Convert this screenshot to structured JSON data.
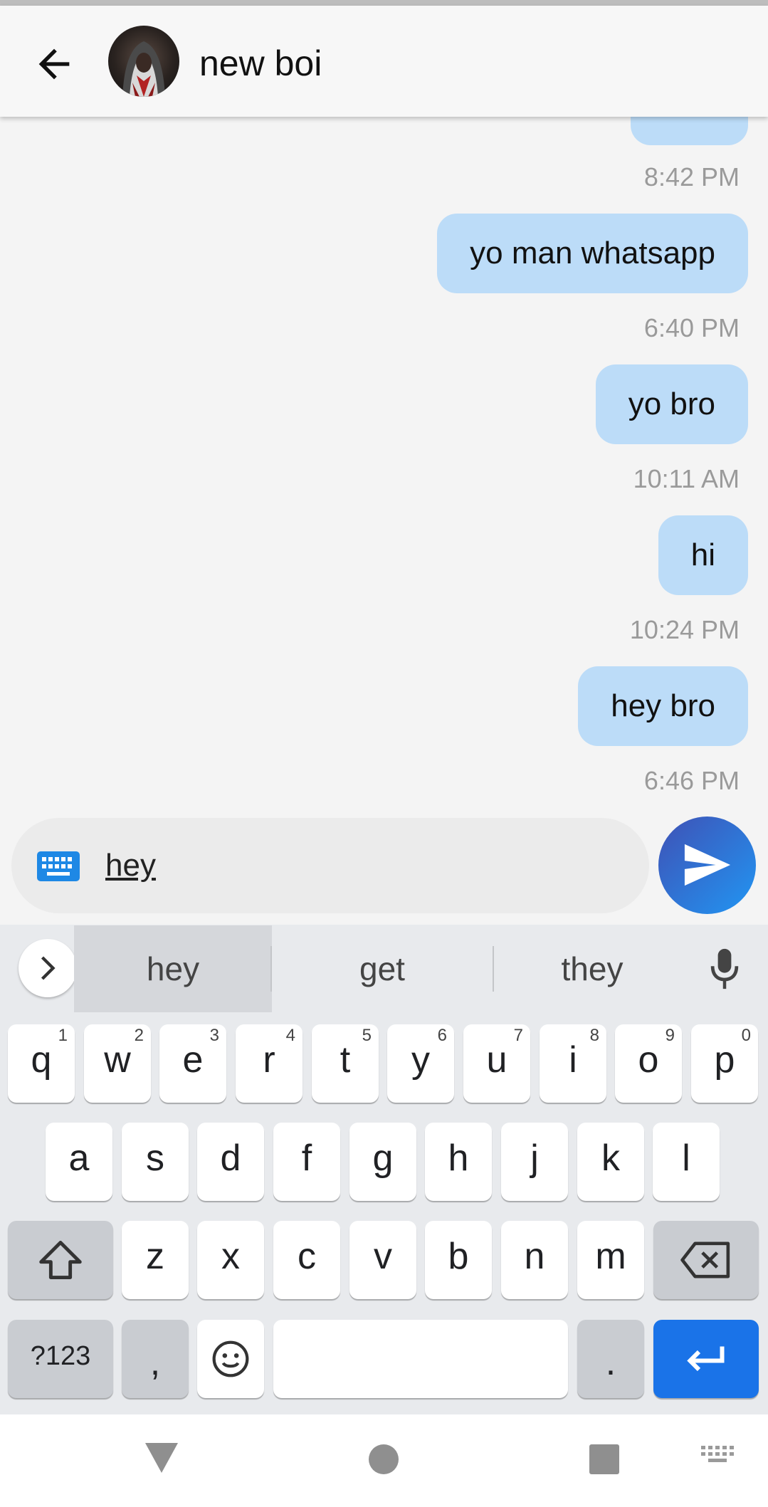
{
  "header": {
    "contact_name": "new boi"
  },
  "messages": [
    {
      "text": "",
      "time": "8:42 PM"
    },
    {
      "text": "yo man whatsapp",
      "time": "6:40 PM"
    },
    {
      "text": "yo bro",
      "time": "10:11 AM"
    },
    {
      "text": "hi",
      "time": "10:24 PM"
    },
    {
      "text": "hey bro",
      "time": "6:46 PM"
    }
  ],
  "composer": {
    "value": "hey"
  },
  "keyboard": {
    "suggestions": [
      "hey",
      "get",
      "they"
    ],
    "row1": [
      "q",
      "w",
      "e",
      "r",
      "t",
      "y",
      "u",
      "i",
      "o",
      "p"
    ],
    "row1_hints": [
      "1",
      "2",
      "3",
      "4",
      "5",
      "6",
      "7",
      "8",
      "9",
      "0"
    ],
    "row2": [
      "a",
      "s",
      "d",
      "f",
      "g",
      "h",
      "j",
      "k",
      "l"
    ],
    "row3": [
      "z",
      "x",
      "c",
      "v",
      "b",
      "n",
      "m"
    ],
    "symbols_label": "?123",
    "comma_label": ",",
    "period_label": "."
  },
  "colors": {
    "bubble": "#bcdcf8",
    "send_gradient_start": "#3f51b5",
    "send_gradient_end": "#2196f3",
    "enter_key": "#1a73e8"
  }
}
